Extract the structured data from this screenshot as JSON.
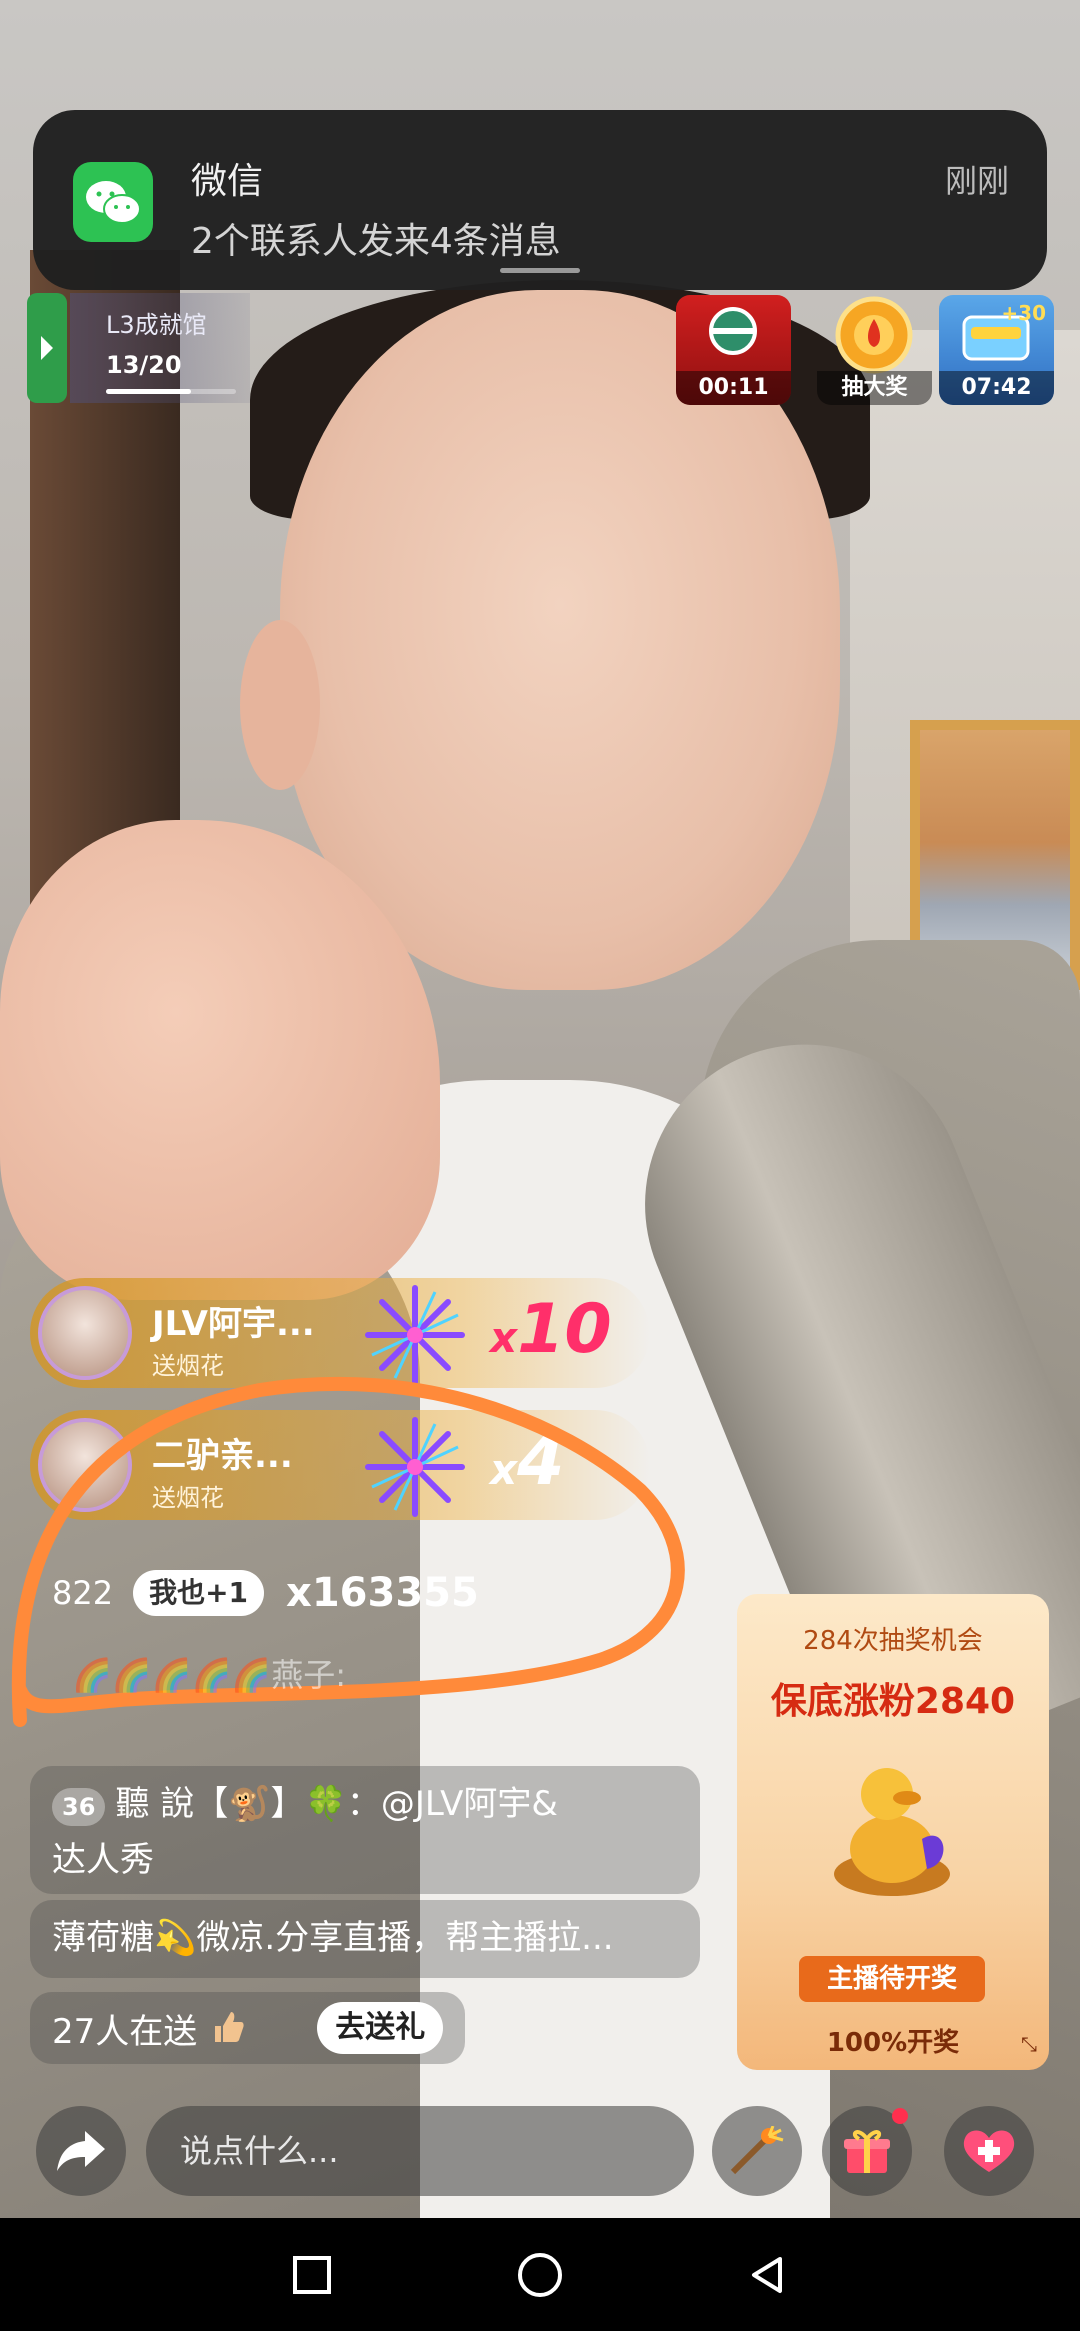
{
  "notification": {
    "app": "微信",
    "message": "2个联系人发来4条消息",
    "time": "刚刚",
    "app_color": "#2dc253"
  },
  "level": {
    "title": "L3成就馆",
    "count": "13/20",
    "progress": 0.65
  },
  "badges": [
    {
      "label": "00:11",
      "icon": "red-packet-timer-icon"
    },
    {
      "label": "抽大奖",
      "icon": "lottery-wheel-icon"
    },
    {
      "label": "07:42",
      "plus": "+30",
      "icon": "popularity-box-icon"
    }
  ],
  "gifts": [
    {
      "name": "JLV阿宇...",
      "action": "送烟花",
      "multiplier": "10"
    },
    {
      "name": "二驴亲...",
      "action": "送烟花",
      "multiplier": "4"
    }
  ],
  "combo": {
    "count": "822",
    "button": "我也+1",
    "total": "x163355"
  },
  "chat": {
    "faded": "🌈🌈🌈🌈🌈燕子:",
    "msg1_level": "36",
    "msg1_line1": "聽 說【🐒】🍀：@JLV阿宇&",
    "msg1_line2": "达人秀",
    "msg2": "薄荷糖💫微凉.分享直播，帮主播拉...",
    "senders": "27人在送",
    "go_gift": "去送礼"
  },
  "lottery": {
    "chances": "284次抽奖机会",
    "guarantee": "保底涨粉2840",
    "button": "主播待开奖",
    "percent": "100%开奖"
  },
  "input": {
    "placeholder": "说点什么..."
  },
  "colors": {
    "accent": "#ff2f6a",
    "annotation": "#ff8a3a"
  }
}
